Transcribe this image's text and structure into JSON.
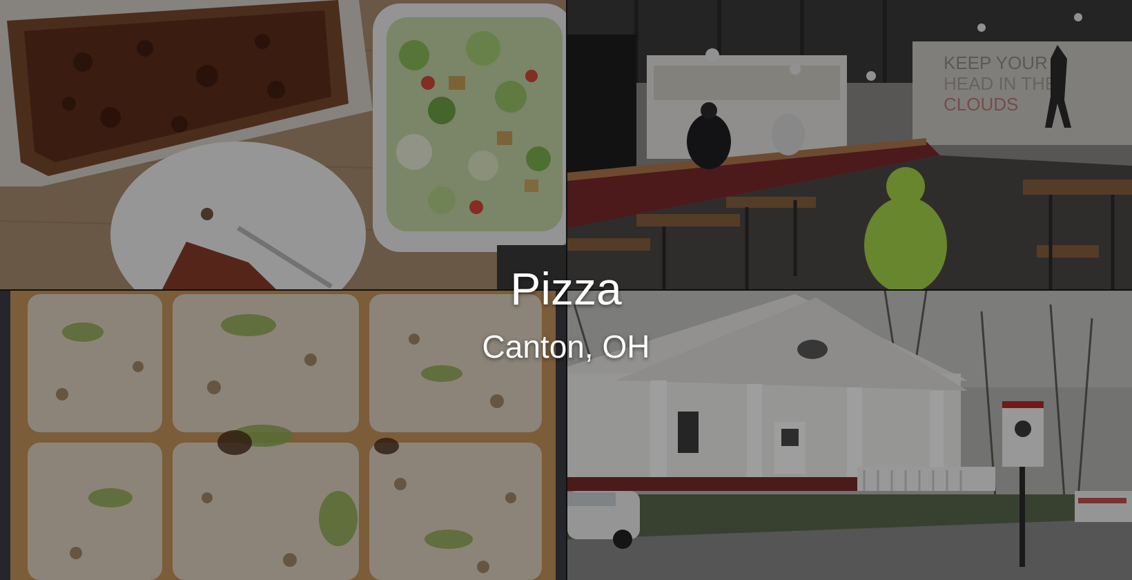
{
  "overlay": {
    "title": "Pizza",
    "subtitle": "Canton, OH"
  },
  "photos": [
    {
      "subject": "pizza-box-with-salad-and-plate"
    },
    {
      "subject": "restaurant-interior-counter"
    },
    {
      "subject": "square-pizza-closeup"
    },
    {
      "subject": "restaurant-exterior-white-house"
    }
  ],
  "colors": {
    "text": "#ffffff",
    "dim_overlay": "rgba(0,0,0,0.38)"
  }
}
